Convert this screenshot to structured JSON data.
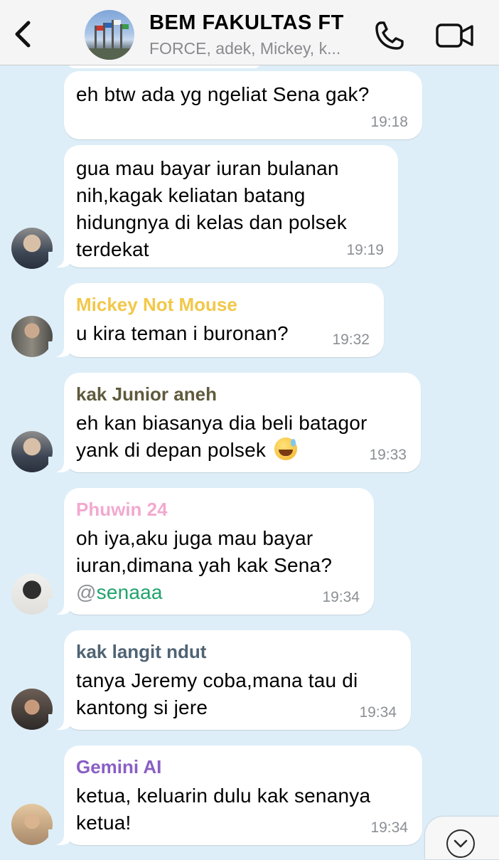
{
  "header": {
    "back_icon": "chevron-left-icon",
    "title": "BEM FAKULTAS FT",
    "members": "FORCE, adek, Mickey, k...",
    "call_icon": "phone-icon",
    "video_icon": "video-camera-icon"
  },
  "messages": [
    {
      "sender": "",
      "sender_color": "",
      "text": "eh btw ada yg ngeliat Sena gak?",
      "time": "19:18"
    },
    {
      "sender": "",
      "sender_color": "",
      "text": "gua mau bayar iuran bulanan\nnih,kagak keliatan batang\nhidungnya di kelas dan polsek\nterdekat",
      "time": "19:19"
    },
    {
      "sender": "Mickey Not Mouse",
      "sender_color": "#f2c84a",
      "text": "u kira teman i buronan?",
      "time": "19:32"
    },
    {
      "sender": "kak Junior aneh",
      "sender_color": "#5f5a3c",
      "text": "eh kan biasanya dia beli batagor\nyank di depan polsek",
      "emoji": "grinning-sweat-emoji",
      "time": "19:33"
    },
    {
      "sender": "Phuwin 24",
      "sender_color": "#f2a9cf",
      "text": "oh iya,aku juga mau bayar\niuran,dimana yah kak Sena?",
      "mention": "@senaaa",
      "time": "19:34"
    },
    {
      "sender": "kak langit ndut",
      "sender_color": "#4f6373",
      "text": "tanya Jeremy coba,mana tau di\nkantong si jere",
      "time": "19:34"
    },
    {
      "sender": "Gemini AI",
      "sender_color": "#8a5fc4",
      "text": "ketua, keluarin dulu kak senanya\nketua!",
      "time": "19:34"
    }
  ],
  "scroll_down_icon": "chevron-down-circle-icon"
}
